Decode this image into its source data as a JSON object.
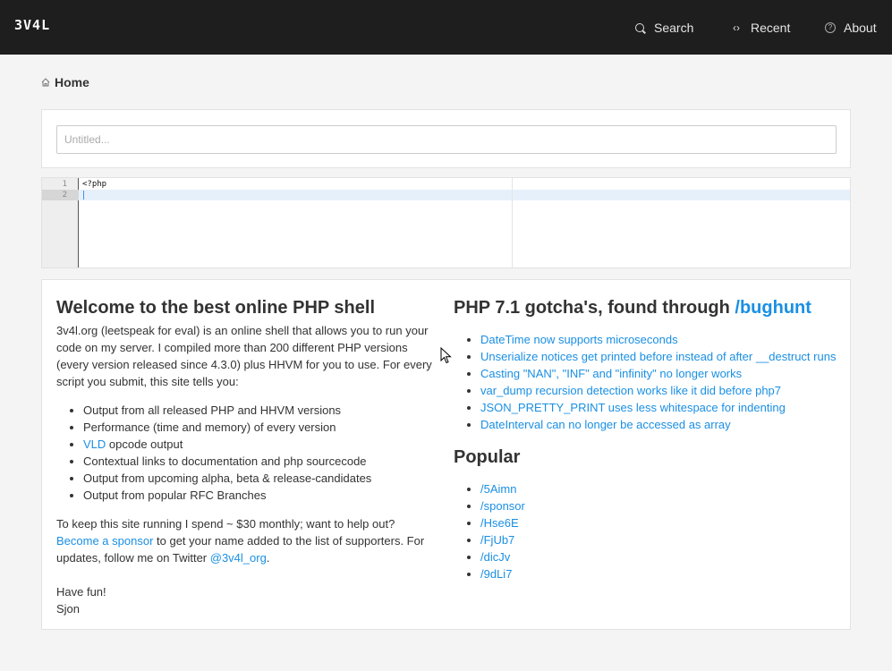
{
  "header": {
    "logo": "3V4L",
    "nav": [
      {
        "label": "Search",
        "icon": "search-icon"
      },
      {
        "label": "Recent",
        "icon": "code-icon"
      },
      {
        "label": "About",
        "icon": "question-icon"
      }
    ]
  },
  "breadcrumb": {
    "label": "Home",
    "icon": "home-icon"
  },
  "title_input": {
    "placeholder": "Untitled...",
    "value": ""
  },
  "editor": {
    "line_numbers": [
      "1",
      "2"
    ],
    "lines": [
      "<?php",
      ""
    ]
  },
  "welcome": {
    "heading": "Welcome to the best online PHP shell",
    "intro": "3v4l.org (leetspeak for eval) is an online shell that allows you to run your code on my server. I compiled more than 200 different PHP versions (every version released since 4.3.0) plus HHVM for you to use. For every script you submit, this site tells you:",
    "features": [
      "Output from all released PHP and HHVM versions",
      "Performance (time and memory) of every version",
      "opcode output",
      "Contextual links to documentation and php sourcecode",
      "Output from upcoming alpha, beta & release-candidates",
      "Output from popular RFC Branches"
    ],
    "vld_link": "VLD",
    "support_text_1": "To keep this site running I spend ~ $30 monthly; want to help out?",
    "sponsor_link": "Become a sponsor",
    "support_text_2": " to get your name added to the list of supporters. For updates, follow me on Twitter ",
    "twitter_link": "@3v4l_org",
    "support_text_3": ".",
    "signoff_1": "Have fun!",
    "signoff_2": "Sjon"
  },
  "gotchas": {
    "heading": "PHP 7.1 gotcha's, found through ",
    "heading_link": "/bughunt",
    "items": [
      "DateTime now supports microseconds",
      "Unserialize notices get printed before instead of after __destruct runs",
      "Casting \"NAN\", \"INF\" and \"infinity\" no longer works",
      "var_dump recursion detection works like it did before php7",
      "JSON_PRETTY_PRINT uses less whitespace for indenting",
      "DateInterval can no longer be accessed as array"
    ]
  },
  "popular": {
    "heading": "Popular",
    "items": [
      "/5Aimn",
      "/sponsor",
      "/Hse6E",
      "/FjUb7",
      "/dicJv",
      "/9dLi7"
    ]
  },
  "colors": {
    "topbar": "#1e1e1e",
    "link": "#1a8fe3",
    "background": "#f4f4f4"
  }
}
